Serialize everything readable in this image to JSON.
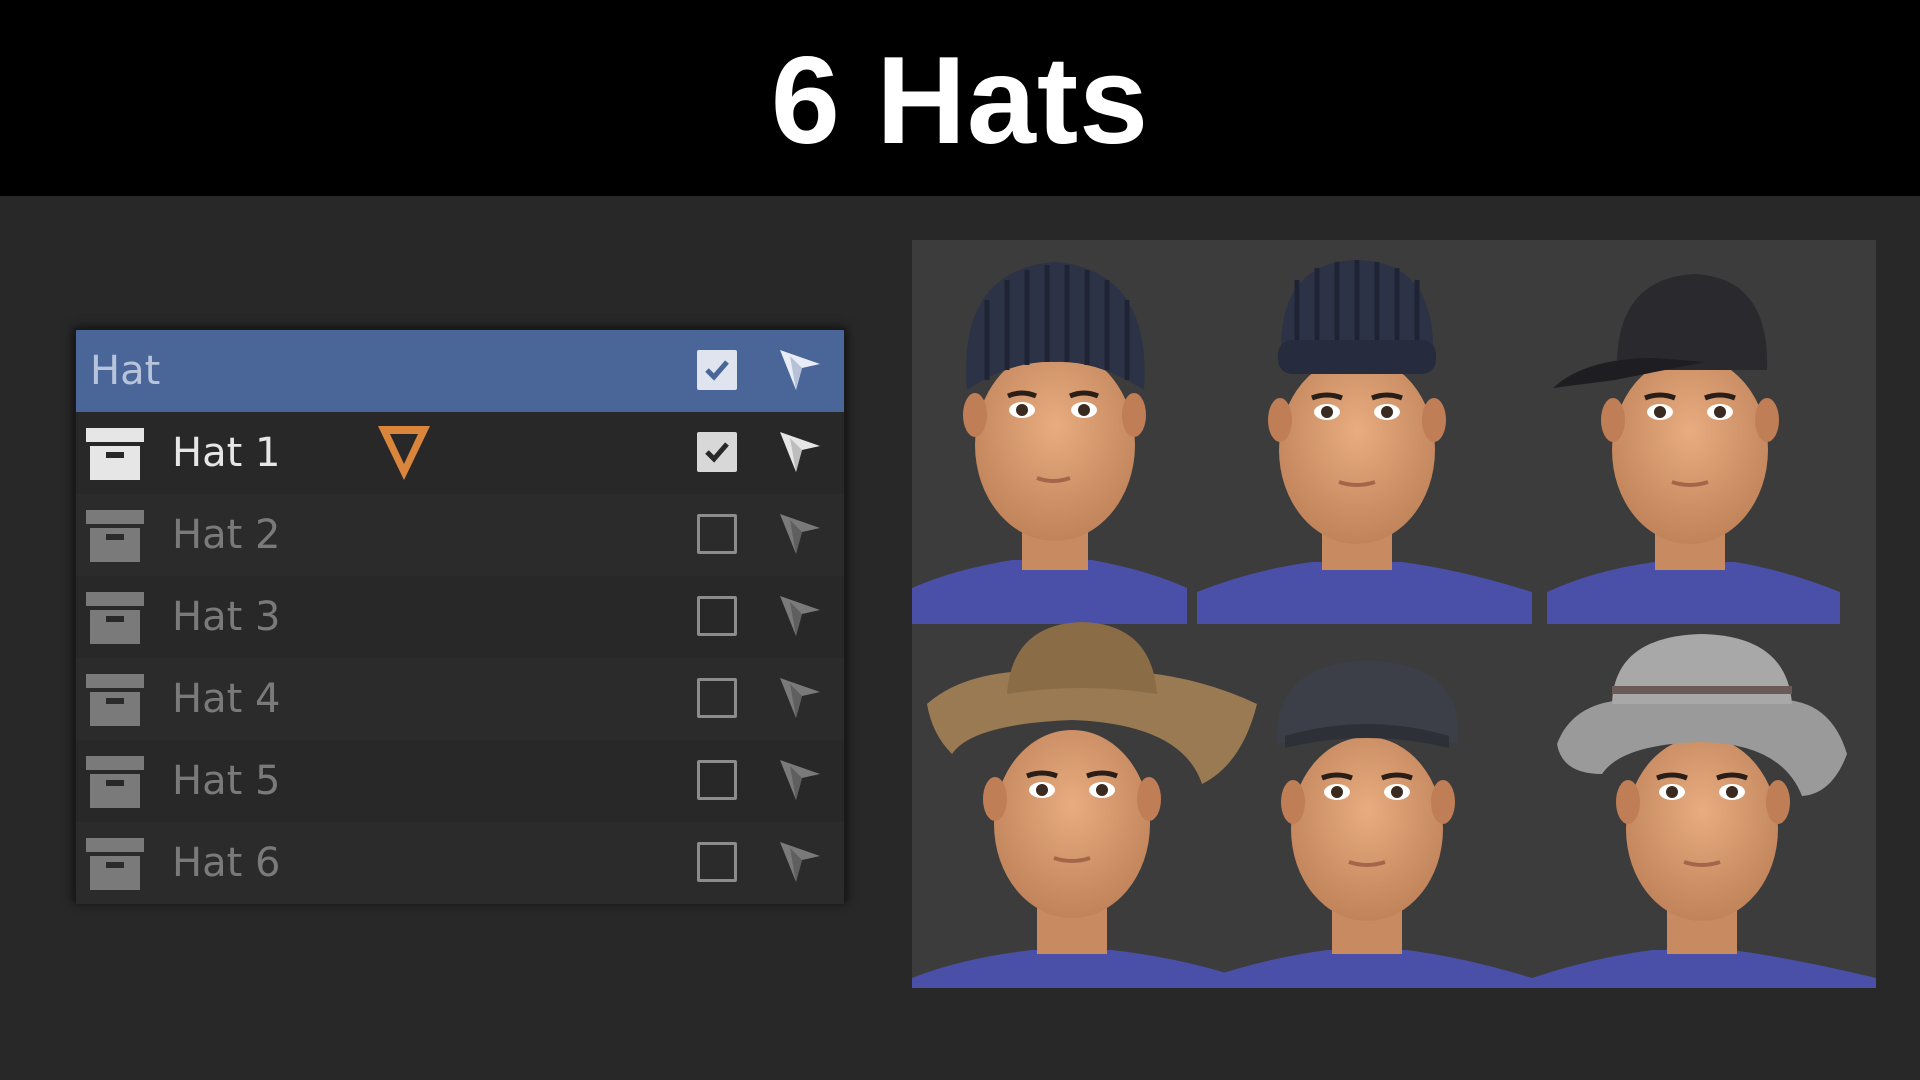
{
  "title": "6 Hats",
  "outliner": {
    "header": {
      "label": "Hat",
      "visible_checked": true,
      "icon": "select-cursor-icon"
    },
    "items": [
      {
        "label": "Hat 1",
        "checked": true,
        "active": true,
        "icon": "archive-box-icon",
        "modifier_icon": "modifier-wrench-triangle-icon"
      },
      {
        "label": "Hat 2",
        "checked": false,
        "active": false,
        "icon": "archive-box-icon"
      },
      {
        "label": "Hat 3",
        "checked": false,
        "active": false,
        "icon": "archive-box-icon"
      },
      {
        "label": "Hat 4",
        "checked": false,
        "active": false,
        "icon": "archive-box-icon"
      },
      {
        "label": "Hat 5",
        "checked": false,
        "active": false,
        "icon": "archive-box-icon"
      },
      {
        "label": "Hat 6",
        "checked": false,
        "active": false,
        "icon": "archive-box-icon"
      }
    ]
  },
  "colors": {
    "header_bg": "#4a6597",
    "panel_bg": "#282828",
    "title_bg": "#000000",
    "accent_orange": "#d9853b",
    "shirt_blue": "#4a4fa8",
    "skin": "#d89a6e"
  },
  "render_grid": {
    "hats": [
      {
        "type": "beanie-tall",
        "color": "#2c3346"
      },
      {
        "type": "beanie-fisherman",
        "color": "#2c3346"
      },
      {
        "type": "baseball-cap",
        "color": "#2a2a2e"
      },
      {
        "type": "cowboy-hat",
        "color": "#9a7a52"
      },
      {
        "type": "newsboy-cap",
        "color": "#3c3e48"
      },
      {
        "type": "bucket-hat",
        "color": "#9a9a9a"
      }
    ]
  }
}
